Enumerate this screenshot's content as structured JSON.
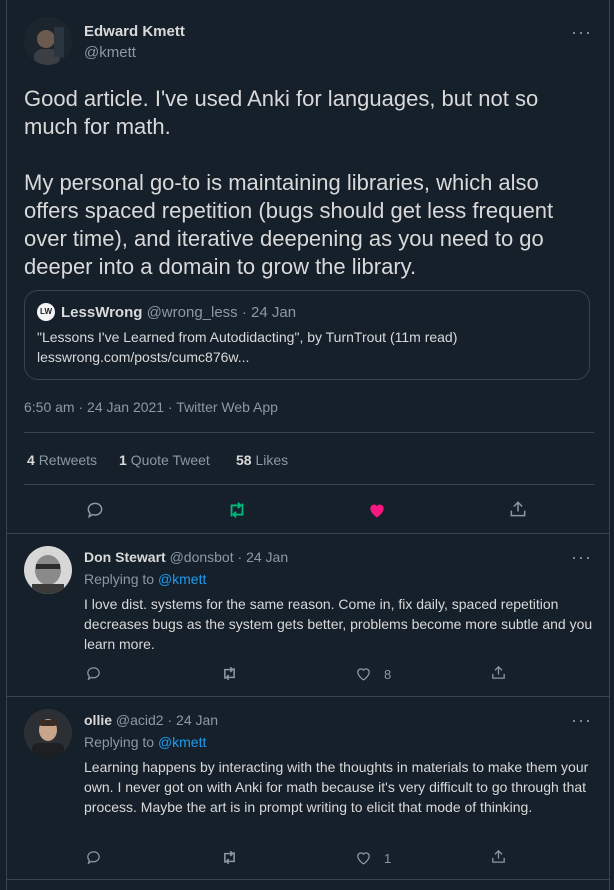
{
  "main_tweet": {
    "author_name": "Edward Kmett",
    "author_handle": "@kmett",
    "text_p1": "Good article. I've used Anki for languages, but not so much for math.",
    "text_p2": "My personal go-to is maintaining libraries, which also offers spaced repetition (bugs should get less frequent over time), and iterative deepening as you need to go deeper into a domain to grow the library.",
    "quote": {
      "logo_text": "LW",
      "author_name": "LessWrong",
      "author_handle": "@wrong_less",
      "date": "· 24 Jan",
      "text": "\"Lessons I've Learned from Autodidacting\", by TurnTrout (11m read)",
      "link": "lesswrong.com/posts/cumc876w..."
    },
    "timestamp": "6:50 am · 24 Jan 2021 · Twitter Web App",
    "stats": {
      "retweets_count": "4",
      "retweets_label": "Retweets",
      "quotes_count": "1",
      "quotes_label": "Quote Tweet",
      "likes_count": "58",
      "likes_label": "Likes"
    }
  },
  "replies": [
    {
      "author_name": "Don Stewart",
      "author_handle": "@donsbot",
      "date": "· 24 Jan",
      "replying_prefix": "Replying to",
      "replying_to": "@kmett",
      "text": "I love dist. systems for the same reason. Come in, fix daily, spaced repetition decreases bugs as the system gets better, problems become more subtle and you learn more.",
      "like_count": "8"
    },
    {
      "author_name": "ollie",
      "author_handle": "@acid2",
      "date": "· 24 Jan",
      "replying_prefix": "Replying to",
      "replying_to": "@kmett",
      "text": "Learning happens by interacting with the thoughts in materials to make them your own. I never got on with Anki for math because it's very difficult to go through that process. Maybe the art is in prompt writing to elicit that mode of thinking.",
      "like_count": "1"
    }
  ],
  "more_label": "···",
  "colors": {
    "background": "#15202b",
    "border": "#38444d",
    "link": "#1d9bf0",
    "retweet_active": "#00ba7c",
    "like_active": "#f91880",
    "muted": "#8b98a5"
  }
}
